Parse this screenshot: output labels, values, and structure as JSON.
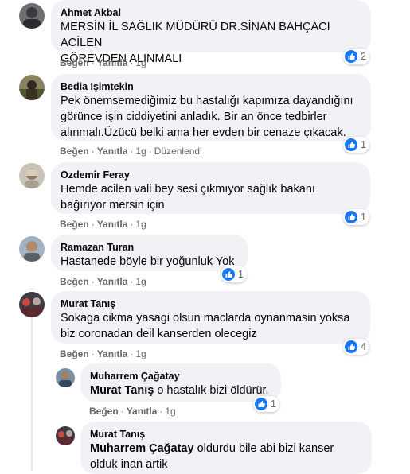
{
  "colors": {
    "bubble": "#f0f2f5",
    "like_blue": "#1877f2",
    "meta_gray": "#65676b"
  },
  "actions": {
    "like": "Beğen",
    "reply": "Yanıtla",
    "sep": "·",
    "edited": "Düzenlendi"
  },
  "comments": [
    {
      "name": "Ahmet Akbal",
      "lines": [
        "MERSİN İL SAĞLIK MÜDÜRÜ DR.SİNAN BAHÇACI ACİLEN",
        "GÖREVDEN ALINMALI"
      ],
      "time": "1g",
      "likes": "2",
      "avatar_icon": "user-photo"
    },
    {
      "name": "Bedia Işimtekin",
      "lines": [
        "Pek önemsemediğimiz bu hastalığı kapımıza dayandığını",
        "görünce işin ciddiyetini anladık. Bir an önce tedbirler",
        "alınmalı.Üzücü belki ama her evden bir cenaze çıkacak."
      ],
      "time": "1g",
      "likes": "1",
      "avatar_icon": "user-photo"
    },
    {
      "name": "Ozdemir Feray",
      "lines": [
        "Hemde acilen vali bey sesi çıkmıyor sağlık bakanı",
        "bağırıyor mersin için"
      ],
      "time": "1g",
      "likes": "1",
      "avatar_icon": "user-photo"
    },
    {
      "name": "Ramazan Turan",
      "lines": [
        "Hastanede böyle bir yoğunluk Yok"
      ],
      "time": "1g",
      "likes": "1",
      "avatar_icon": "user-photo"
    },
    {
      "name": "Murat Tanış",
      "lines": [
        "Sokaga cikma yasagi olsun maclarda oynanmasin yoksa",
        "biz coronadan deil kanserden olecegiz"
      ],
      "time": "1g",
      "likes": "4",
      "avatar_icon": "user-photo"
    }
  ],
  "replies": [
    {
      "name": "Muharrem Çağatay",
      "mention": "Murat Tanış",
      "text": " o hastalık bizi öldürür.",
      "time": "1g",
      "likes": "1"
    },
    {
      "name": "Murat Tanış",
      "mention": "Muharrem Çağatay",
      "text": " oldurdu bile abi bizi kanser",
      "line2": "olduk inan artik"
    }
  ]
}
